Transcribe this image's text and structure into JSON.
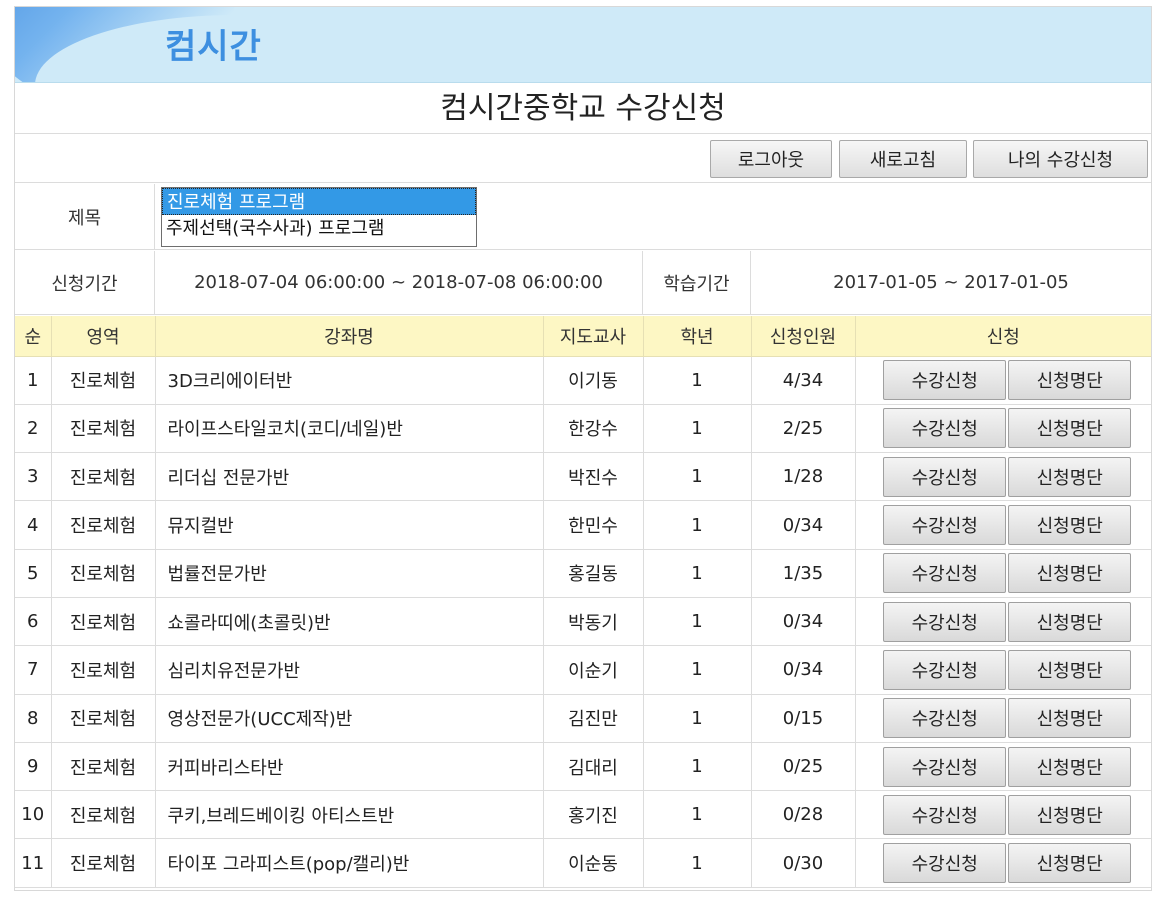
{
  "banner": {
    "logo_text": "컴시간"
  },
  "page_title": "컴시간중학교 수강신청",
  "toolbar": {
    "logout": "로그아웃",
    "refresh": "새로고침",
    "my_courses": "나의 수강신청"
  },
  "program": {
    "label": "제목",
    "options": [
      "진로체험 프로그램",
      "주제선택(국수사과) 프로그램"
    ],
    "selected_index": 0
  },
  "period": {
    "apply_label": "신청기간",
    "apply_value": "2018-07-04 06:00:00 ~ 2018-07-08 06:00:00",
    "study_label": "학습기간",
    "study_value": "2017-01-05 ~ 2017-01-05"
  },
  "table": {
    "headers": {
      "no": "순",
      "area": "영역",
      "name": "강좌명",
      "teacher": "지도교사",
      "grade": "학년",
      "count": "신청인원",
      "apply": "신청"
    },
    "apply_button": "수강신청",
    "list_button": "신청명단",
    "rows": [
      {
        "no": "1",
        "area": "진로체험",
        "name": "3D크리에이터반",
        "teacher": "이기동",
        "grade": "1",
        "count": "4/34"
      },
      {
        "no": "2",
        "area": "진로체험",
        "name": "라이프스타일코치(코디/네일)반",
        "teacher": "한강수",
        "grade": "1",
        "count": "2/25"
      },
      {
        "no": "3",
        "area": "진로체험",
        "name": "리더십 전문가반",
        "teacher": "박진수",
        "grade": "1",
        "count": "1/28"
      },
      {
        "no": "4",
        "area": "진로체험",
        "name": "뮤지컬반",
        "teacher": "한민수",
        "grade": "1",
        "count": "0/34"
      },
      {
        "no": "5",
        "area": "진로체험",
        "name": "법률전문가반",
        "teacher": "홍길동",
        "grade": "1",
        "count": "1/35"
      },
      {
        "no": "6",
        "area": "진로체험",
        "name": "쇼콜라띠에(초콜릿)반",
        "teacher": "박동기",
        "grade": "1",
        "count": "0/34"
      },
      {
        "no": "7",
        "area": "진로체험",
        "name": "심리치유전문가반",
        "teacher": "이순기",
        "grade": "1",
        "count": "0/34"
      },
      {
        "no": "8",
        "area": "진로체험",
        "name": "영상전문가(UCC제작)반",
        "teacher": "김진만",
        "grade": "1",
        "count": "0/15"
      },
      {
        "no": "9",
        "area": "진로체험",
        "name": "커피바리스타반",
        "teacher": "김대리",
        "grade": "1",
        "count": "0/25"
      },
      {
        "no": "10",
        "area": "진로체험",
        "name": "쿠키,브레드베이킹 아티스트반",
        "teacher": "홍기진",
        "grade": "1",
        "count": "0/28"
      },
      {
        "no": "11",
        "area": "진로체험",
        "name": "타이포 그라피스트(pop/캘리)반",
        "teacher": "이순동",
        "grade": "1",
        "count": "0/30"
      }
    ]
  }
}
